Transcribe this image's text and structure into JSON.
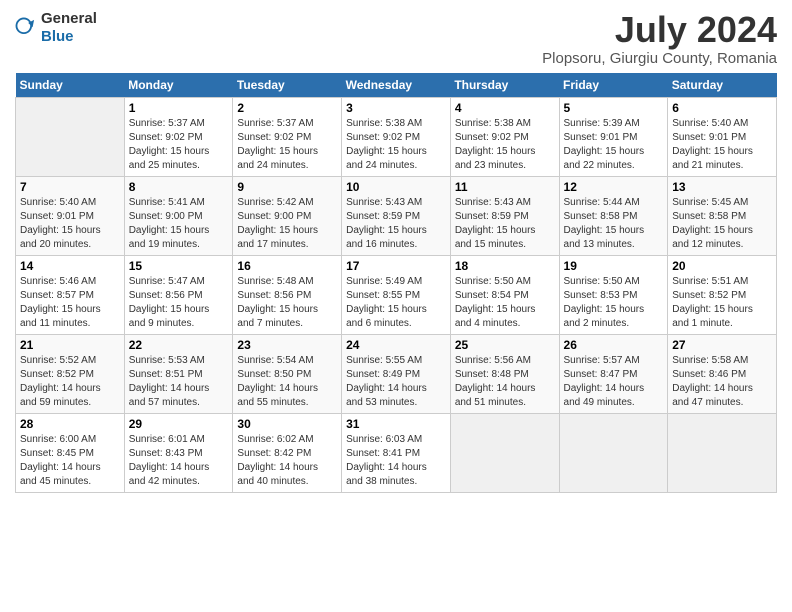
{
  "logo": {
    "text_general": "General",
    "text_blue": "Blue"
  },
  "title": "July 2024",
  "subtitle": "Plopsoru, Giurgiu County, Romania",
  "days_of_week": [
    "Sunday",
    "Monday",
    "Tuesday",
    "Wednesday",
    "Thursday",
    "Friday",
    "Saturday"
  ],
  "weeks": [
    [
      {
        "num": "",
        "info": ""
      },
      {
        "num": "1",
        "info": "Sunrise: 5:37 AM\nSunset: 9:02 PM\nDaylight: 15 hours\nand 25 minutes."
      },
      {
        "num": "2",
        "info": "Sunrise: 5:37 AM\nSunset: 9:02 PM\nDaylight: 15 hours\nand 24 minutes."
      },
      {
        "num": "3",
        "info": "Sunrise: 5:38 AM\nSunset: 9:02 PM\nDaylight: 15 hours\nand 24 minutes."
      },
      {
        "num": "4",
        "info": "Sunrise: 5:38 AM\nSunset: 9:02 PM\nDaylight: 15 hours\nand 23 minutes."
      },
      {
        "num": "5",
        "info": "Sunrise: 5:39 AM\nSunset: 9:01 PM\nDaylight: 15 hours\nand 22 minutes."
      },
      {
        "num": "6",
        "info": "Sunrise: 5:40 AM\nSunset: 9:01 PM\nDaylight: 15 hours\nand 21 minutes."
      }
    ],
    [
      {
        "num": "7",
        "info": "Sunrise: 5:40 AM\nSunset: 9:01 PM\nDaylight: 15 hours\nand 20 minutes."
      },
      {
        "num": "8",
        "info": "Sunrise: 5:41 AM\nSunset: 9:00 PM\nDaylight: 15 hours\nand 19 minutes."
      },
      {
        "num": "9",
        "info": "Sunrise: 5:42 AM\nSunset: 9:00 PM\nDaylight: 15 hours\nand 17 minutes."
      },
      {
        "num": "10",
        "info": "Sunrise: 5:43 AM\nSunset: 8:59 PM\nDaylight: 15 hours\nand 16 minutes."
      },
      {
        "num": "11",
        "info": "Sunrise: 5:43 AM\nSunset: 8:59 PM\nDaylight: 15 hours\nand 15 minutes."
      },
      {
        "num": "12",
        "info": "Sunrise: 5:44 AM\nSunset: 8:58 PM\nDaylight: 15 hours\nand 13 minutes."
      },
      {
        "num": "13",
        "info": "Sunrise: 5:45 AM\nSunset: 8:58 PM\nDaylight: 15 hours\nand 12 minutes."
      }
    ],
    [
      {
        "num": "14",
        "info": "Sunrise: 5:46 AM\nSunset: 8:57 PM\nDaylight: 15 hours\nand 11 minutes."
      },
      {
        "num": "15",
        "info": "Sunrise: 5:47 AM\nSunset: 8:56 PM\nDaylight: 15 hours\nand 9 minutes."
      },
      {
        "num": "16",
        "info": "Sunrise: 5:48 AM\nSunset: 8:56 PM\nDaylight: 15 hours\nand 7 minutes."
      },
      {
        "num": "17",
        "info": "Sunrise: 5:49 AM\nSunset: 8:55 PM\nDaylight: 15 hours\nand 6 minutes."
      },
      {
        "num": "18",
        "info": "Sunrise: 5:50 AM\nSunset: 8:54 PM\nDaylight: 15 hours\nand 4 minutes."
      },
      {
        "num": "19",
        "info": "Sunrise: 5:50 AM\nSunset: 8:53 PM\nDaylight: 15 hours\nand 2 minutes."
      },
      {
        "num": "20",
        "info": "Sunrise: 5:51 AM\nSunset: 8:52 PM\nDaylight: 15 hours\nand 1 minute."
      }
    ],
    [
      {
        "num": "21",
        "info": "Sunrise: 5:52 AM\nSunset: 8:52 PM\nDaylight: 14 hours\nand 59 minutes."
      },
      {
        "num": "22",
        "info": "Sunrise: 5:53 AM\nSunset: 8:51 PM\nDaylight: 14 hours\nand 57 minutes."
      },
      {
        "num": "23",
        "info": "Sunrise: 5:54 AM\nSunset: 8:50 PM\nDaylight: 14 hours\nand 55 minutes."
      },
      {
        "num": "24",
        "info": "Sunrise: 5:55 AM\nSunset: 8:49 PM\nDaylight: 14 hours\nand 53 minutes."
      },
      {
        "num": "25",
        "info": "Sunrise: 5:56 AM\nSunset: 8:48 PM\nDaylight: 14 hours\nand 51 minutes."
      },
      {
        "num": "26",
        "info": "Sunrise: 5:57 AM\nSunset: 8:47 PM\nDaylight: 14 hours\nand 49 minutes."
      },
      {
        "num": "27",
        "info": "Sunrise: 5:58 AM\nSunset: 8:46 PM\nDaylight: 14 hours\nand 47 minutes."
      }
    ],
    [
      {
        "num": "28",
        "info": "Sunrise: 6:00 AM\nSunset: 8:45 PM\nDaylight: 14 hours\nand 45 minutes."
      },
      {
        "num": "29",
        "info": "Sunrise: 6:01 AM\nSunset: 8:43 PM\nDaylight: 14 hours\nand 42 minutes."
      },
      {
        "num": "30",
        "info": "Sunrise: 6:02 AM\nSunset: 8:42 PM\nDaylight: 14 hours\nand 40 minutes."
      },
      {
        "num": "31",
        "info": "Sunrise: 6:03 AM\nSunset: 8:41 PM\nDaylight: 14 hours\nand 38 minutes."
      },
      {
        "num": "",
        "info": ""
      },
      {
        "num": "",
        "info": ""
      },
      {
        "num": "",
        "info": ""
      }
    ]
  ]
}
